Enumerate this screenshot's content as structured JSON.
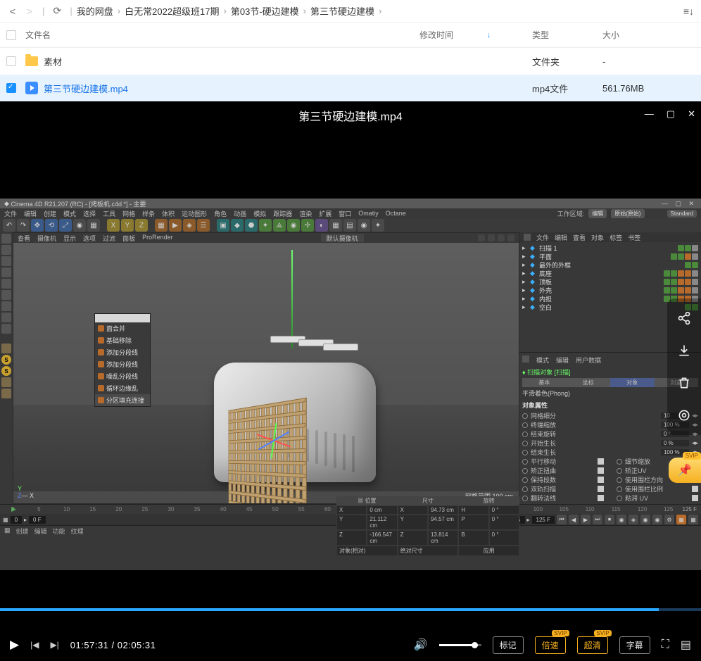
{
  "nav": {
    "back": "<",
    "fwd": ">",
    "refresh": "⟳",
    "viewmode": "≡↓"
  },
  "breadcrumb": [
    "我的网盘",
    "白无常2022超级班17期",
    "第03节-硬边建模",
    "第三节硬边建模"
  ],
  "columns": {
    "name": "文件名",
    "mtime": "修改时间",
    "type": "类型",
    "size": "大小"
  },
  "rows": [
    {
      "name": "素材",
      "kind": "folder",
      "type": "文件夹",
      "size": "-",
      "selected": false
    },
    {
      "name": "第三节硬边建模.mp4",
      "kind": "video",
      "type": "mp4文件",
      "size": "561.76MB",
      "selected": true
    }
  ],
  "video": {
    "title": "第三节硬边建模.mp4",
    "current": "01:57:31",
    "total": "02:05:31",
    "btn_mark": "标记",
    "btn_speed": "倍速",
    "btn_quality": "超清",
    "btn_sub": "字幕",
    "speed_tag": "SVIP",
    "quality_tag": "SVIP"
  },
  "c4d": {
    "title": "Cinema 4D R21.207 (RC) - [烤板机.c4d *] - 主要",
    "menus": [
      "文件",
      "编辑",
      "创建",
      "模式",
      "选择",
      "工具",
      "网格",
      "样条",
      "体积",
      "运动图形",
      "角色",
      "动画",
      "模拟",
      "跟踪器",
      "渲染",
      "扩展",
      "窗口",
      "Omatiy",
      "Octane"
    ],
    "layout_label": "工作区域:",
    "layout_opts": [
      "编辑",
      "原始(原始)"
    ],
    "layout_std": "Standard",
    "vp_menus": [
      "查看",
      "摄像机",
      "显示",
      "选项",
      "过滤",
      "面板",
      "ProRender"
    ],
    "vp_cam": "默认摄像机",
    "ctx": [
      "面合并",
      "基础移除",
      "添加分段线",
      "添加分段线",
      "噪乱分段线",
      "循环边缘乱",
      "分区填充连接"
    ],
    "grid": "网格范围  100 cm",
    "tabs1": [
      "文件",
      "编辑",
      "查看",
      "对象",
      "标签",
      "书签"
    ],
    "hier": [
      {
        "n": "扫描 1",
        "d": [
          "g",
          "g",
          "chk2"
        ]
      },
      {
        "n": "平面",
        "d": [
          "g",
          "g",
          "o",
          "chk2"
        ]
      },
      {
        "n": "最外的外框",
        "d": [
          "g",
          "g"
        ]
      },
      {
        "n": "底座",
        "d": [
          "g",
          "g",
          "o",
          "o",
          "chk2"
        ]
      },
      {
        "n": "顶板",
        "d": [
          "g",
          "g",
          "o",
          "o",
          "chk2"
        ]
      },
      {
        "n": "外壳",
        "d": [
          "g",
          "g",
          "o",
          "o",
          "chk2"
        ]
      },
      {
        "n": "内担",
        "d": [
          "g",
          "g",
          "o",
          "o",
          "chk2"
        ]
      },
      {
        "n": "空白",
        "d": [
          "g",
          "g"
        ]
      }
    ],
    "attr_tabs": [
      "模式",
      "编辑",
      "用户数据"
    ],
    "attr_obj": "扫描对象 [扫描]",
    "attr_sub": [
      "基本",
      "坐标",
      "对象",
      "封盖"
    ],
    "phong": "平滑着色(Phong)",
    "props_hdr": "对象属性",
    "props": [
      {
        "l": "网格细分",
        "v": "10"
      },
      {
        "l": "终端缩放",
        "v": "100 %"
      },
      {
        "l": "结束旋转",
        "v": "0 °"
      },
      {
        "l": "开始生长",
        "v": "0 %"
      },
      {
        "l": "结束生长",
        "v": "100 %"
      }
    ],
    "checks": [
      [
        "平行移动",
        "",
        "细节缩放",
        ""
      ],
      [
        "矫正扭曲",
        "",
        "矫正UV",
        ""
      ],
      [
        "保持段数",
        "",
        "使用围栏方向",
        ""
      ],
      [
        "双轨扫描",
        "",
        "使用围栏比例",
        ""
      ],
      [
        "翻转法线",
        "",
        "粘滞 UV",
        ""
      ]
    ],
    "tl": {
      "start": "0",
      "cur": "0 F",
      "end": "125",
      "max": "125 F",
      "nf": "125 F"
    },
    "mat_tabs": [
      "创建",
      "编辑",
      "功能",
      "纹理"
    ],
    "coord": {
      "hd": [
        "位置",
        "尺寸",
        "旋转"
      ],
      "rows": [
        [
          "X",
          "0 cm",
          "X",
          "94.73 cm",
          "H",
          "0 °"
        ],
        [
          "Y",
          "21.112 cm",
          "Y",
          "94.57 cm",
          "P",
          "0 °"
        ],
        [
          "Z",
          "-166.547 cm",
          "Z",
          "13.814 cm",
          "B",
          "0 °"
        ]
      ],
      "mode": [
        "对象(相对)",
        "绝对尺寸",
        "应用"
      ]
    }
  },
  "svip": "SVIP"
}
